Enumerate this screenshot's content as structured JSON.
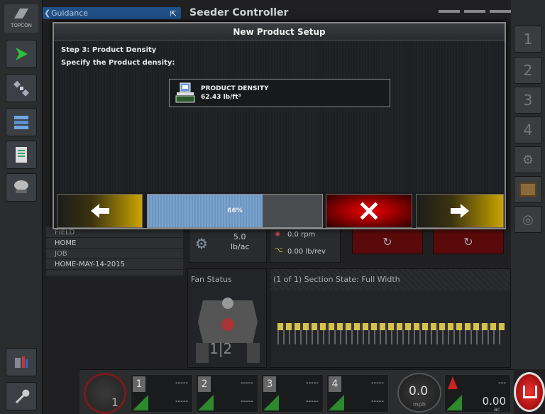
{
  "topbar": {
    "guidance_label": "Guidance",
    "title": "Seeder Controller"
  },
  "sidebar_logo": "TOPCON",
  "right_sidebar": [
    "1",
    "2",
    "3",
    "4"
  ],
  "info": {
    "field_label": "FIELD",
    "field_value": "HOME",
    "job_label": "JOB",
    "job_value": "HOME-MAY-14-2015"
  },
  "rates": {
    "rate_value": "5.0",
    "rate_unit": "lb/ac",
    "rpm": "0.0 rpm",
    "rev": "0.00 lb/rev"
  },
  "fan_status_label": "Fan Status",
  "fan_numbers": "1|2",
  "section_state": "(1 of 1) Section State: Full Width",
  "bottom": {
    "slots": [
      {
        "num": "1",
        "top": "-----",
        "bottom": "-----"
      },
      {
        "num": "2",
        "top": "-----",
        "bottom": "-----"
      },
      {
        "num": "3",
        "top": "-----",
        "bottom": "-----"
      },
      {
        "num": "4",
        "top": "-----",
        "bottom": "-----"
      }
    ],
    "speed": "0.0",
    "speed_unit": "mph",
    "area_top": "---",
    "area": "0.00",
    "area_unit": "ac",
    "left_dial_num": "1"
  },
  "dialog": {
    "title": "New Product Setup",
    "step": "Step 3: Product Density",
    "instruction": "Specify the Product density:",
    "density_label": "PRODUCT DENSITY",
    "density_value": "62.43 lb/ft³",
    "progress_label": "66%",
    "progress": 0.66
  },
  "colors": {
    "accent_blue": "#1f4f85",
    "yellow": "#c9a400",
    "red": "#e00000",
    "progress": "#7aa2cc"
  }
}
